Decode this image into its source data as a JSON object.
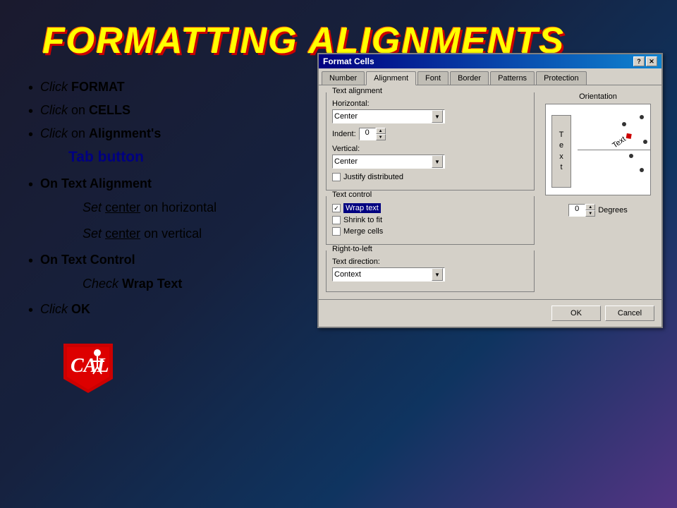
{
  "title": "FORMATTING ALIGNMENTS",
  "bullets": [
    {
      "id": "b1",
      "text_italic": "Click",
      "text_bold": "FORMAT",
      "text_rest": ""
    },
    {
      "id": "b2",
      "text_italic": "Click",
      "text_rest": " on ",
      "text_bold": "CELLS"
    },
    {
      "id": "b3",
      "text_italic": "Click",
      "text_rest": " on ",
      "text_bold": "Alignment's"
    }
  ],
  "indent_tab": "Tab button",
  "bullet4": "On Text Alignment",
  "sub1_em": "Set",
  "sub1_u": "center",
  "sub1_rest": " on horizontal",
  "sub2_em": "Set",
  "sub2_u": "center",
  "sub2_rest": " on vertical",
  "bullet5": "On Text Control",
  "sub3_em": "Check",
  "sub3_bold": "Wrap Text",
  "bullet6_em": "Click",
  "bullet6_bold": "OK",
  "dialog": {
    "title": "Format Cells",
    "tabs": [
      "Number",
      "Alignment",
      "Font",
      "Border",
      "Patterns",
      "Protection"
    ],
    "active_tab": "Alignment",
    "text_alignment_label": "Text alignment",
    "horizontal_label": "Horizontal:",
    "horizontal_value": "Center",
    "indent_label": "Indent:",
    "indent_value": "0",
    "vertical_label": "Vertical:",
    "vertical_value": "Center",
    "justify_label": "Justify distributed",
    "text_control_label": "Text control",
    "wrap_text_label": "Wrap text",
    "shrink_label": "Shrink to fit",
    "merge_label": "Merge cells",
    "rtl_label": "Right-to-left",
    "text_direction_label": "Text direction:",
    "text_direction_value": "Context",
    "orientation_label": "Orientation",
    "text_label": "Text",
    "degrees_value": "0",
    "degrees_label": "Degrees",
    "ok_label": "OK",
    "cancel_label": "Cancel"
  }
}
